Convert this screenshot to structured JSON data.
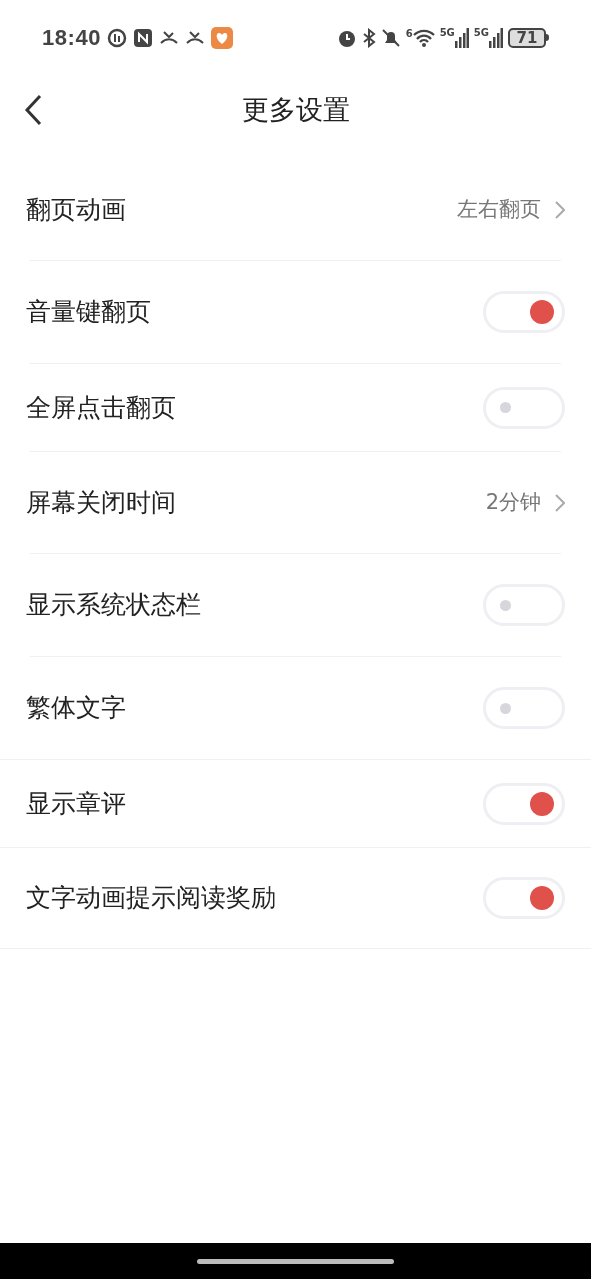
{
  "status_bar": {
    "time": "18:40",
    "wifi_badge": "6",
    "network_1": "5G",
    "network_2": "5G",
    "battery": "71"
  },
  "header": {
    "title": "更多设置"
  },
  "settings": [
    {
      "kind": "link",
      "label": "翻页动画",
      "value": "左右翻页"
    },
    {
      "kind": "toggle",
      "label": "音量键翻页",
      "on": true
    },
    {
      "kind": "toggle",
      "label": "全屏点击翻页",
      "on": false
    },
    {
      "kind": "link",
      "label": "屏幕关闭时间",
      "value": "2分钟"
    },
    {
      "kind": "toggle",
      "label": "显示系统状态栏",
      "on": false
    },
    {
      "kind": "toggle",
      "label": "繁体文字",
      "on": false
    },
    {
      "kind": "toggle",
      "label": "显示章评",
      "on": true
    },
    {
      "kind": "toggle",
      "label": "文字动画提示阅读奖励",
      "on": true
    }
  ]
}
